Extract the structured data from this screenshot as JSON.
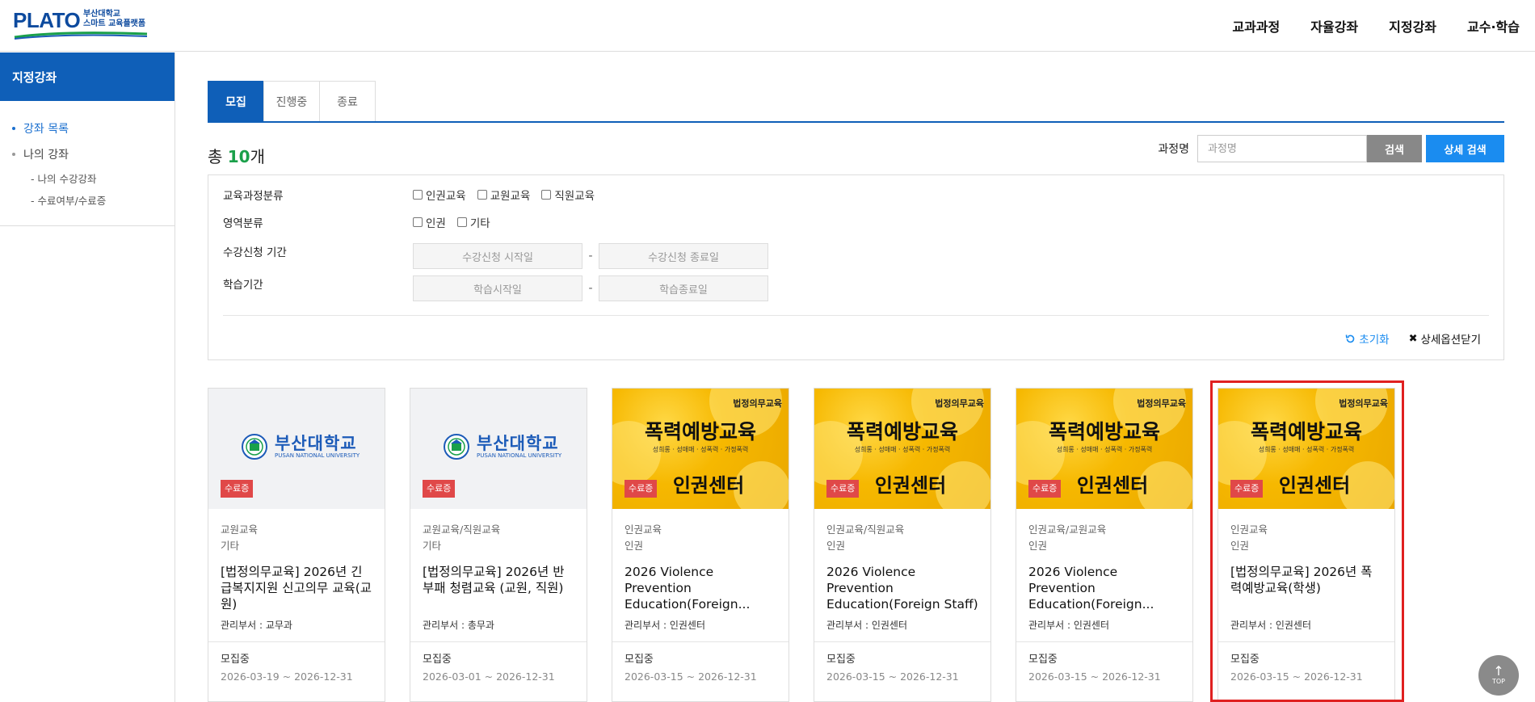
{
  "header": {
    "logo_main": "PLATO",
    "logo_sub_line1": "부산대학교",
    "logo_sub_line2": "스마트 교육플랫폼",
    "nav": [
      "교과과정",
      "자율강좌",
      "지정강좌",
      "교수·학습"
    ]
  },
  "sidebar": {
    "title": "지정강좌",
    "items": [
      {
        "label": "강좌 목록",
        "active": true
      },
      {
        "label": "나의 강좌",
        "active": false
      }
    ],
    "sub_items": [
      "- 나의 수강강좌",
      "- 수료여부/수료증"
    ]
  },
  "tabs": [
    {
      "label": "모집",
      "active": true
    },
    {
      "label": "진행중",
      "active": false
    },
    {
      "label": "종료",
      "active": false
    }
  ],
  "summary": {
    "prefix": "총 ",
    "count": "10",
    "suffix": "개"
  },
  "search": {
    "label": "과정명",
    "placeholder": "과정명",
    "button": "검색",
    "detail_button": "상세 검색"
  },
  "filter": {
    "rows": [
      {
        "label": "교육과정분류",
        "options": [
          "인권교육",
          "교원교육",
          "직원교육"
        ]
      },
      {
        "label": "영역분류",
        "options": [
          "인권",
          "기타"
        ]
      }
    ],
    "apply_period_label": "수강신청 기간",
    "apply_start": "수강신청 시작일",
    "apply_end": "수강신청 종료일",
    "study_period_label": "학습기간",
    "study_start": "학습시작일",
    "study_end": "학습종료일",
    "dash": "-",
    "reset": "초기화",
    "close_detail": "상세옵션닫기"
  },
  "thumb_text": {
    "pnu_ko": "부산대학교",
    "pnu_en": "PUSAN NATIONAL UNIVERSITY",
    "legal": "법정의무교육",
    "violence_title": "폭력예방교육",
    "violence_sub": "성희롱 · 성매매 · 성폭력 · 가정폭력",
    "center": "인권센터",
    "badge": "수료증"
  },
  "courses": [
    {
      "thumb": "pnu",
      "cat1": "교원교육",
      "cat2": "기타",
      "title": "[법정의무교육] 2026년 긴급복지지원 신고의무 교육(교원)",
      "dept": "관리부서 : 교무과",
      "status": "모집중",
      "period": "2026-03-19 ~ 2026-12-31"
    },
    {
      "thumb": "pnu",
      "cat1": "교원교육/직원교육",
      "cat2": "기타",
      "title": "[법정의무교육] 2026년 반부패 청렴교육 (교원, 직원)",
      "dept": "관리부서 : 총무과",
      "status": "모집중",
      "period": "2026-03-01 ~ 2026-12-31"
    },
    {
      "thumb": "violence",
      "cat1": "인권교육",
      "cat2": "인권",
      "title": "2026 Violence Prevention Education(Foreign...",
      "dept": "관리부서 : 인권센터",
      "status": "모집중",
      "period": "2026-03-15 ~ 2026-12-31"
    },
    {
      "thumb": "violence",
      "cat1": "인권교육/직원교육",
      "cat2": "인권",
      "title": "2026 Violence Prevention Education(Foreign Staff)",
      "dept": "관리부서 : 인권센터",
      "status": "모집중",
      "period": "2026-03-15 ~ 2026-12-31"
    },
    {
      "thumb": "violence",
      "cat1": "인권교육/교원교육",
      "cat2": "인권",
      "title": "2026 Violence Prevention Education(Foreign...",
      "dept": "관리부서 : 인권센터",
      "status": "모집중",
      "period": "2026-03-15 ~ 2026-12-31"
    },
    {
      "thumb": "violence",
      "cat1": "인권교육",
      "cat2": "인권",
      "title": "[법정의무교육] 2026년 폭력예방교육(학생)",
      "dept": "관리부서 : 인권센터",
      "status": "모집중",
      "period": "2026-03-15 ~ 2026-12-31"
    }
  ],
  "top_button": "TOP",
  "colors": {
    "primary": "#0f5fb8",
    "accent_blue": "#1a8cf0",
    "count_green": "#1aa04a",
    "badge_red": "#e04848",
    "highlight_red": "#e02020"
  }
}
